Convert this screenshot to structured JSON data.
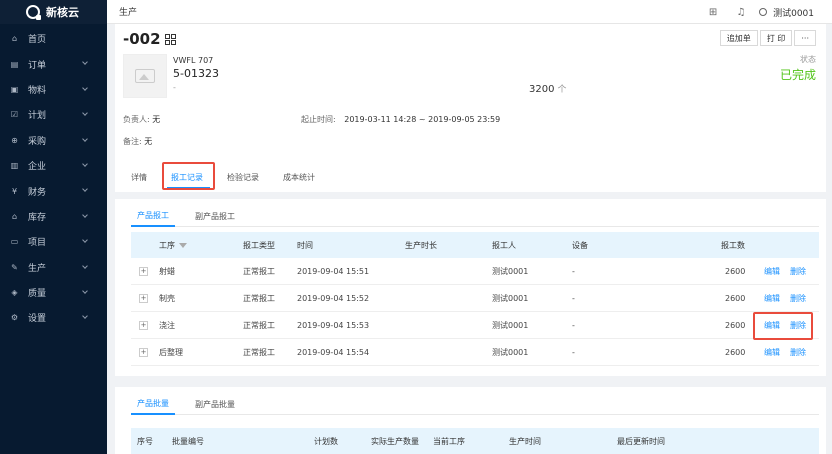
{
  "brand": {
    "name": "新核云"
  },
  "sidebar": {
    "items": [
      {
        "label": "首页",
        "icon": "home-icon",
        "has_children": false
      },
      {
        "label": "订单",
        "icon": "order-icon",
        "has_children": true
      },
      {
        "label": "物料",
        "icon": "material-icon",
        "has_children": true
      },
      {
        "label": "计划",
        "icon": "plan-icon",
        "has_children": true
      },
      {
        "label": "采购",
        "icon": "purchase-icon",
        "has_children": true
      },
      {
        "label": "企业",
        "icon": "company-icon",
        "has_children": true
      },
      {
        "label": "财务",
        "icon": "finance-icon",
        "has_children": true
      },
      {
        "label": "库存",
        "icon": "inventory-icon",
        "has_children": true
      },
      {
        "label": "项目",
        "icon": "project-icon",
        "has_children": true
      },
      {
        "label": "生产",
        "icon": "production-icon",
        "has_children": true
      },
      {
        "label": "质量",
        "icon": "quality-icon",
        "has_children": true
      },
      {
        "label": "设置",
        "icon": "settings-icon",
        "has_children": true
      }
    ]
  },
  "topbar": {
    "breadcrumb": "生产",
    "user": "测试0001"
  },
  "header": {
    "order_no": "-002",
    "buttons": {
      "add_order": "追加单",
      "print": "打 印",
      "more": "···"
    },
    "status_label": "状态",
    "status_value": "已完成",
    "product_code": "VWFL 707",
    "product_name": "5-01323",
    "product_spec": "-",
    "quantity": "3200",
    "unit": "个",
    "owner_label": "负责人:",
    "owner_value": "无",
    "time_label": "起止时间:",
    "time_value": "2019-03-11 14:28 ~ 2019-09-05 23:59",
    "note_label": "备注:",
    "note_value": "无",
    "tabs": [
      "详情",
      "报工记录",
      "检验记录",
      "成本统计"
    ]
  },
  "report_card": {
    "subtabs": [
      "产品报工",
      "副产品报工"
    ],
    "columns": {
      "process": "工序",
      "type": "报工类型",
      "time": "时间",
      "duration": "生产时长",
      "reporter": "报工人",
      "device": "设备",
      "qty": "报工数"
    },
    "rows": [
      {
        "process": "射蜡",
        "type": "正常报工",
        "time": "2019-09-04 15:51",
        "duration": "",
        "reporter": "测试0001",
        "device": "-",
        "qty": "2600",
        "edit": "编辑",
        "delete": "删除"
      },
      {
        "process": "制壳",
        "type": "正常报工",
        "time": "2019-09-04 15:52",
        "duration": "",
        "reporter": "测试0001",
        "device": "-",
        "qty": "2600",
        "edit": "编辑",
        "delete": "删除"
      },
      {
        "process": "浇注",
        "type": "正常报工",
        "time": "2019-09-04 15:53",
        "duration": "",
        "reporter": "测试0001",
        "device": "-",
        "qty": "2600",
        "edit": "编辑",
        "delete": "删除"
      },
      {
        "process": "后整理",
        "type": "正常报工",
        "time": "2019-09-04 15:54",
        "duration": "",
        "reporter": "测试0001",
        "device": "-",
        "qty": "2600",
        "edit": "编辑",
        "delete": "删除"
      }
    ]
  },
  "batch_card": {
    "subtabs": [
      "产品批量",
      "副产品批量"
    ],
    "columns": {
      "seq": "序号",
      "batch_no": "批量编号",
      "planned": "计划数",
      "actual": "实际生产数量",
      "current_process": "当前工序",
      "prod_time": "生产时间",
      "updated": "最后更新时间"
    }
  },
  "colors": {
    "accent": "#1890ff",
    "success": "#52c41a",
    "highlight": "#e94b3c",
    "sidebar": "#071a30"
  }
}
